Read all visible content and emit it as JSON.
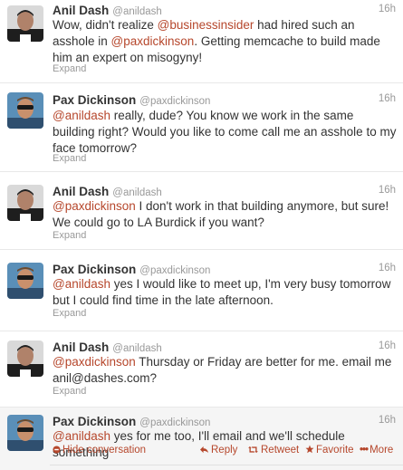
{
  "tweets": [
    {
      "name": "Anil Dash",
      "handle": "@anildash",
      "time": "16h",
      "expand": "Expand",
      "segments": [
        {
          "t": "Wow, didn't realize ",
          "m": false
        },
        {
          "t": "@businessinsider",
          "m": true
        },
        {
          "t": " had hired such an asshole in ",
          "m": false
        },
        {
          "t": "@paxdickinson",
          "m": true
        },
        {
          "t": ". Getting memcache to build made him an expert on misogyny!",
          "m": false
        }
      ]
    },
    {
      "name": "Pax Dickinson",
      "handle": "@paxdickinson",
      "time": "16h",
      "expand": "Expand",
      "segments": [
        {
          "t": "@anildash",
          "m": true
        },
        {
          "t": " really, dude? You know we work in the same building right? Would you like to come call me an asshole to my face tomorrow?",
          "m": false
        }
      ]
    },
    {
      "name": "Anil Dash",
      "handle": "@anildash",
      "time": "16h",
      "expand": "Expand",
      "segments": [
        {
          "t": "@paxdickinson",
          "m": true
        },
        {
          "t": " I don't work in that building anymore, but sure! We could go to LA Burdick if you want?",
          "m": false
        }
      ]
    },
    {
      "name": "Pax Dickinson",
      "handle": "@paxdickinson",
      "time": "16h",
      "expand": "Expand",
      "segments": [
        {
          "t": "@anildash",
          "m": true
        },
        {
          "t": " yes I would like to meet up, I'm very busy tomorrow but I could find time in the late afternoon.",
          "m": false
        }
      ]
    },
    {
      "name": "Anil Dash",
      "handle": "@anildash",
      "time": "16h",
      "expand": "Expand",
      "segments": [
        {
          "t": "@paxdickinson",
          "m": true
        },
        {
          "t": " Thursday or Friday are better for me. email me anil@dashes.com?",
          "m": false
        }
      ]
    },
    {
      "name": "Pax Dickinson",
      "handle": "@paxdickinson",
      "time": "16h",
      "expand": "",
      "segments": [
        {
          "t": "@anildash",
          "m": true
        },
        {
          "t": " yes for me too, I'll email and we'll schedule something",
          "m": false
        }
      ]
    }
  ],
  "actions": {
    "hide": "Hide conversation",
    "reply": "Reply",
    "retweet": "Retweet",
    "favorite": "Favorite",
    "more": "More"
  },
  "icons": {
    "hide": "collapse-circle-icon",
    "reply": "reply-arrow-icon",
    "retweet": "retweet-icon",
    "favorite": "star-icon",
    "more": "ellipsis-icon"
  },
  "colors": {
    "mention": "#b6472c",
    "meta": "#999999",
    "divider": "#e8e8e8"
  }
}
